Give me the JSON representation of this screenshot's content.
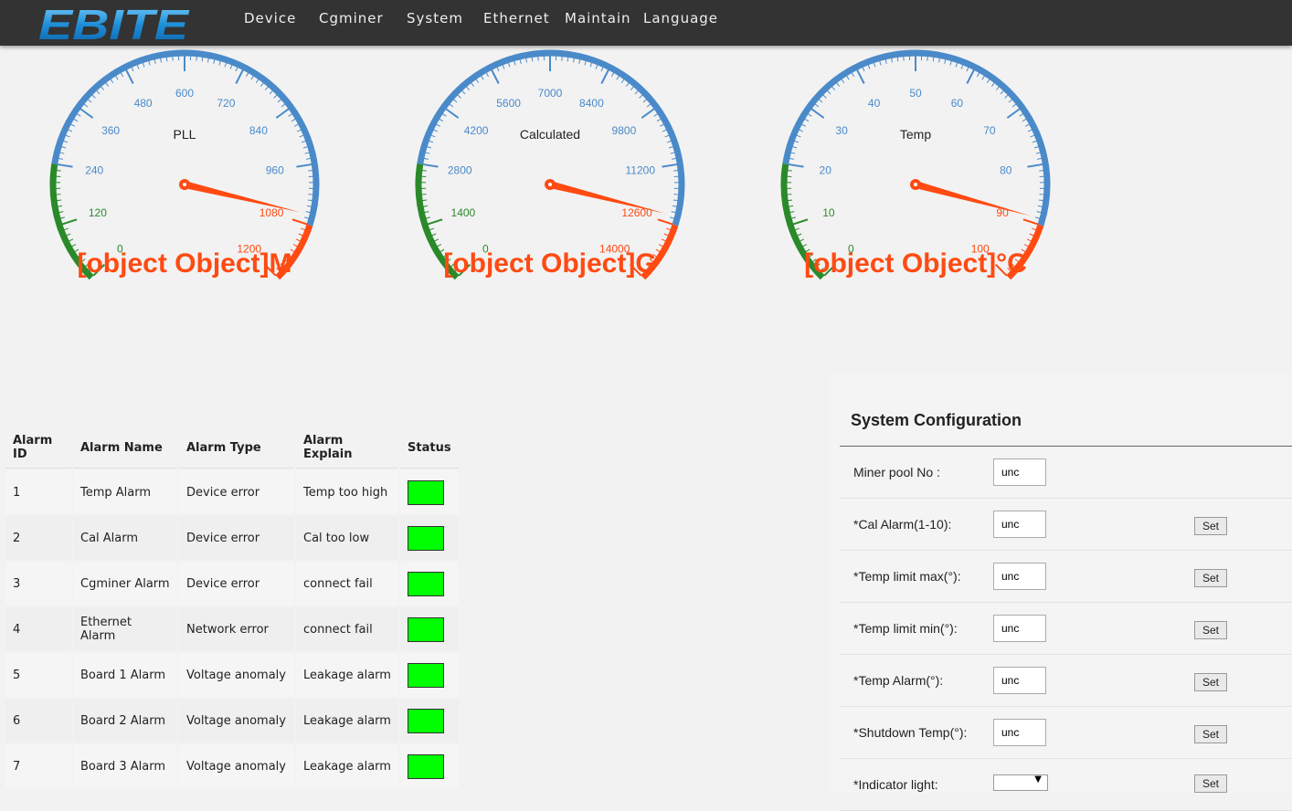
{
  "brand": {
    "logo_text": "EBITE"
  },
  "nav": [
    "Device",
    "Cgminer",
    "System",
    "Ethernet",
    "Maintain",
    "Language"
  ],
  "gauges": [
    {
      "title": "PLL",
      "value_text": "[object Object]M",
      "min": 0,
      "max": 1200,
      "step": 120,
      "green_to": 240,
      "red_from": 1080,
      "needle_value": 1060,
      "labels": [
        "0",
        "120",
        "240",
        "360",
        "480",
        "600",
        "720",
        "840",
        "960",
        "1080",
        "1200"
      ]
    },
    {
      "title": "Calculated",
      "value_text": "[object Object]G",
      "min": 0,
      "max": 14000,
      "step": 1400,
      "green_to": 2800,
      "red_from": 12600,
      "needle_value": 12400,
      "labels": [
        "0",
        "1400",
        "2800",
        "4200",
        "5600",
        "7000",
        "8400",
        "9800",
        "11200",
        "12600",
        "14000"
      ]
    },
    {
      "title": "Temp",
      "value_text": "[object Object]°C",
      "min": 0,
      "max": 100,
      "step": 10,
      "green_to": 20,
      "red_from": 90,
      "needle_value": 89,
      "labels": [
        "0",
        "10",
        "20",
        "30",
        "40",
        "50",
        "60",
        "70",
        "80",
        "90",
        "100"
      ]
    }
  ],
  "gauge_colors": {
    "blue": "#4a8ac9",
    "green": "#2a8a2a",
    "red": "#ff4a12",
    "value": "#ff4a12"
  },
  "alarms": {
    "headers": [
      "Alarm ID",
      "Alarm Name",
      "Alarm Type",
      "Alarm Explain",
      "Status"
    ],
    "rows": [
      [
        "1",
        "Temp Alarm",
        "Device error",
        "Temp too high"
      ],
      [
        "2",
        "Cal Alarm",
        "Device error",
        "Cal too low"
      ],
      [
        "3",
        "Cgminer Alarm",
        "Device error",
        "connect fail"
      ],
      [
        "4",
        "Ethernet Alarm",
        "Network error",
        "connect fail"
      ],
      [
        "5",
        "Board 1 Alarm",
        "Voltage anomaly",
        "Leakage alarm"
      ],
      [
        "6",
        "Board 2 Alarm",
        "Voltage anomaly",
        "Leakage alarm"
      ],
      [
        "7",
        "Board 3 Alarm",
        "Voltage anomaly",
        "Leakage alarm"
      ]
    ],
    "status_color": "#00ff00"
  },
  "config": {
    "title": "System Configuration",
    "rows": [
      {
        "label": "Miner pool No :",
        "value": "unc",
        "button": ""
      },
      {
        "label": "*Cal Alarm(1-10):",
        "value": "unc",
        "button": "Set"
      },
      {
        "label": "*Temp limit max(°):",
        "value": "unc",
        "button": "Set"
      },
      {
        "label": "*Temp limit min(°):",
        "value": "unc",
        "button": "Set"
      },
      {
        "label": "*Temp Alarm(°):",
        "value": "unc",
        "button": "Set"
      },
      {
        "label": "*Shutdown Temp(°):",
        "value": "unc",
        "button": "Set"
      },
      {
        "label": "*Indicator light:",
        "value": "",
        "button": "Set",
        "select": true
      }
    ]
  }
}
